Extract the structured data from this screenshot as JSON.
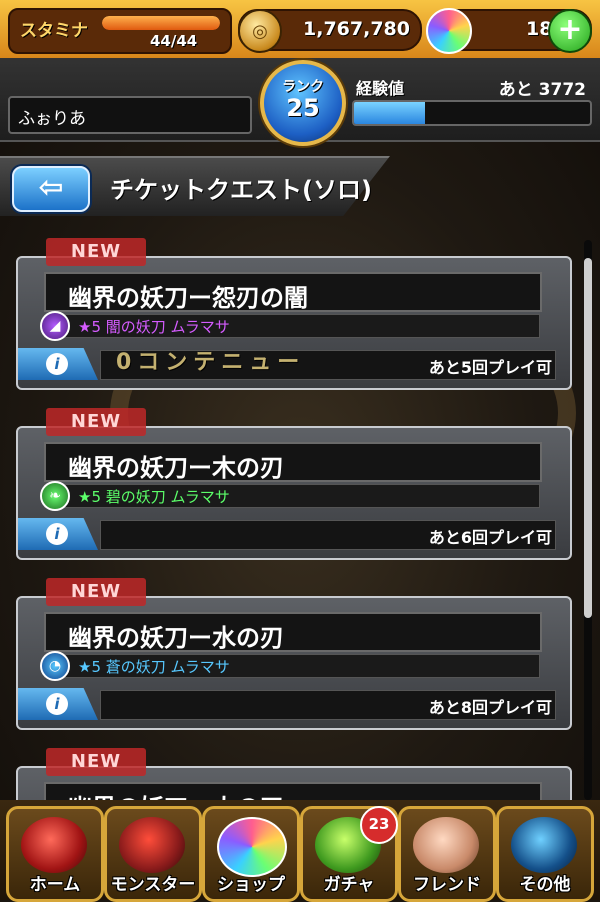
{
  "status": {
    "stamina_label": "スタミナ",
    "stamina_value": "44/44",
    "stamina_fraction": 1.0,
    "coins": "1,767,780",
    "orbs": "18"
  },
  "player": {
    "name": "ふぉりあ",
    "rank_label": "ランク",
    "rank": "25",
    "exp_label": "経験値",
    "exp_remaining": "あと 3772",
    "exp_fraction": 0.3
  },
  "header": {
    "title": "チケットクエスト(ソロ)"
  },
  "event_banner": "0コンテニュー",
  "quests": [
    {
      "badge": "NEW",
      "title": "幽界の妖刀ー怨刃の闇",
      "subtitle": "★5 闇の妖刀 ムラマサ",
      "remaining": "あと5回プレイ可",
      "element": "dark",
      "color": "#d55cff"
    },
    {
      "badge": "NEW",
      "title": "幽界の妖刀ー木の刃",
      "subtitle": "★5 碧の妖刀 ムラマサ",
      "remaining": "あと6回プレイ可",
      "element": "wood",
      "color": "#5cff6a"
    },
    {
      "badge": "NEW",
      "title": "幽界の妖刀ー水の刃",
      "subtitle": "★5 蒼の妖刀 ムラマサ",
      "remaining": "あと8回プレイ可",
      "element": "water",
      "color": "#57c8ff"
    },
    {
      "badge": "NEW",
      "title": "幽界の妖刀ー火の刃"
    }
  ],
  "nav": {
    "home": "ホーム",
    "monster": "モンスター",
    "shop": "ショップ",
    "gacha": "ガチャ",
    "gacha_badge": "23",
    "friend": "フレンド",
    "other": "その他"
  }
}
